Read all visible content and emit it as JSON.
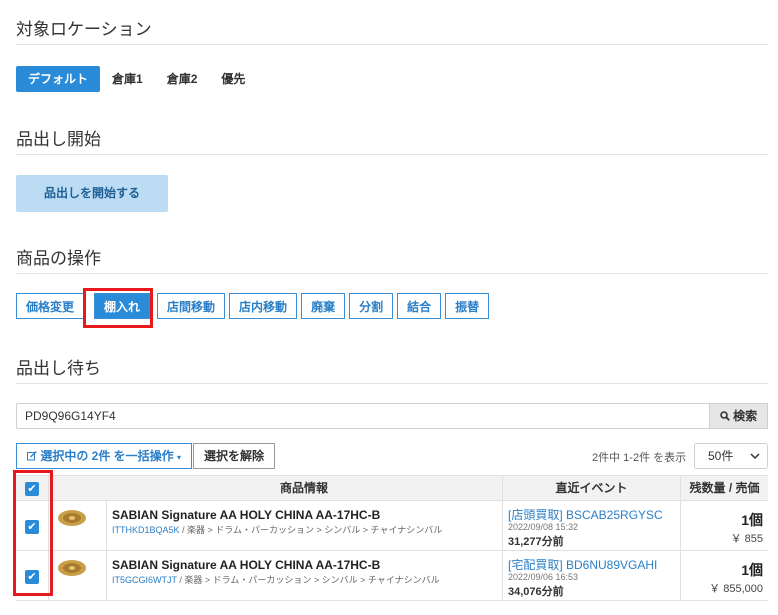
{
  "sections": {
    "location": "対象ロケーション",
    "picking_start": "品出し開始",
    "product_ops": "商品の操作",
    "waiting": "品出し待ち"
  },
  "location_tabs": [
    "デフォルト",
    "倉庫1",
    "倉庫2",
    "優先"
  ],
  "start_button": "品出しを開始する",
  "op_buttons": [
    "価格変更",
    "棚入れ",
    "店間移動",
    "店内移動",
    "廃棄",
    "分割",
    "結合",
    "振替"
  ],
  "search": {
    "value": "PD9Q96G14YF4",
    "button": "検索"
  },
  "bulk": {
    "label": "選択中の 2件 を一括操作",
    "clear": "選択を解除"
  },
  "count_text": "2件中 1-2件 を表示",
  "per_page": "50件",
  "table": {
    "headers": [
      "商品情報",
      "直近イベント",
      "残数量 / 売価"
    ],
    "rows": [
      {
        "name": "SABIAN Signature AA HOLY CHINA AA-17HC-B",
        "code": "ITTHKD1BQA5K",
        "path": " / 楽器 > ドラム・パーカッション > シンバル > チャイナシンバル",
        "event": "[店頭買取] BSCAB25RGYSC",
        "date": "2022/09/08 15:32",
        "ago": "31,277分前",
        "qty": "1個",
        "price": "￥ 855"
      },
      {
        "name": "SABIAN Signature AA HOLY CHINA AA-17HC-B",
        "code": "IT5GCGI6WTJT",
        "path": " / 楽器 > ドラム・パーカッション > シンバル > チャイナシンバル",
        "event": "[宅配買取] BD6NU89VGAHI",
        "date": "2022/09/06 16:53",
        "ago": "34,076分前",
        "qty": "1個",
        "price": "￥ 855,000"
      }
    ]
  },
  "colors": {
    "accent": "#2a8bd8",
    "highlight": "#e8191c"
  }
}
